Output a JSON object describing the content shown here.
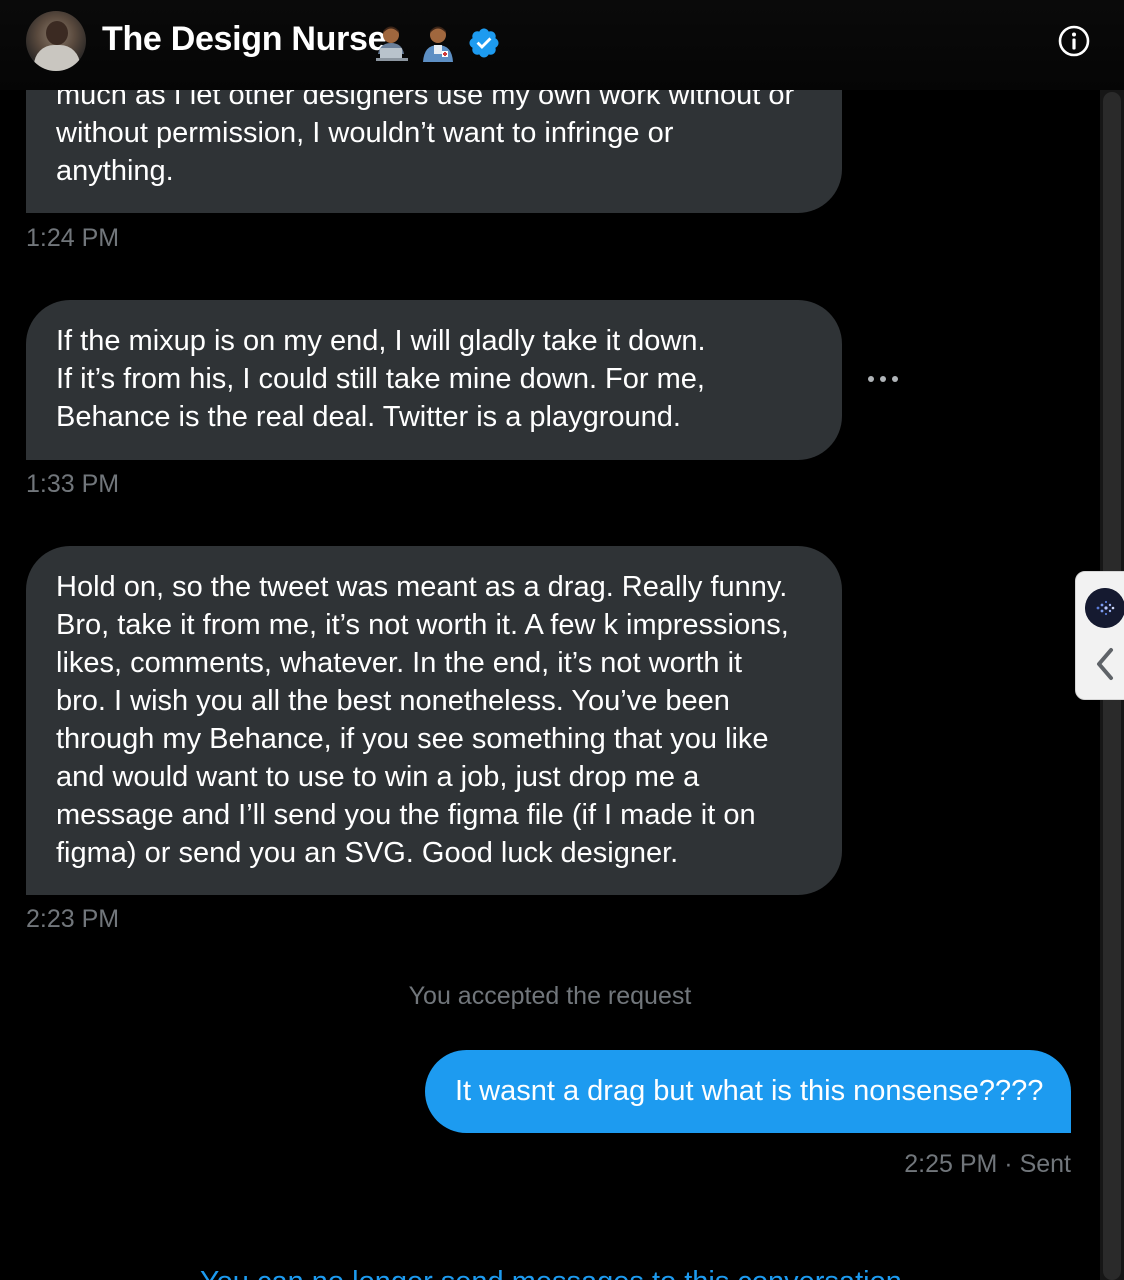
{
  "header": {
    "name": "The Design Nurse",
    "emoji_1": "man-technologist-emoji",
    "emoji_2": "man-health-worker-emoji",
    "verified_icon": "verified-badge-icon",
    "info_icon": "info-icon"
  },
  "messages": [
    {
      "lines": [
        "much as I let other designers use my own work without or",
        "without permission, I wouldn’t want to infringe or",
        "anything."
      ],
      "time": "1:24 PM"
    },
    {
      "lines": [
        "If the mixup is on my end, I will gladly take it down.",
        "If it’s from his, I could still take mine down. For me,",
        "Behance is the real deal. Twitter is a playground."
      ],
      "time": "1:33 PM"
    },
    {
      "lines": [
        "Hold on, so the tweet was meant as a drag. Really funny.",
        "Bro, take it from me, it’s not worth it. A few k impressions,",
        "likes, comments, whatever. In the end, it’s not worth it",
        "bro. I wish you all the best nonetheless. You’ve been",
        "through my Behance, if you see something that you like",
        "and would want to use to win a job, just drop me a",
        "message and I’ll send you the figma file (if I made it on",
        "figma) or send you an SVG. Good luck designer."
      ],
      "time": "2:23 PM"
    }
  ],
  "system_message": "You accepted the request",
  "sent_message": {
    "text": "It wasnt a drag but what is this nonsense????",
    "time": "2:25 PM",
    "separator": "·",
    "status": "Sent"
  },
  "cut_off_text": "You can no longer send messages to this conversation",
  "colors": {
    "background": "#000000",
    "received_bubble": "#2f3336",
    "sent_bubble": "#1d9bf0",
    "muted_text": "#71767b"
  }
}
